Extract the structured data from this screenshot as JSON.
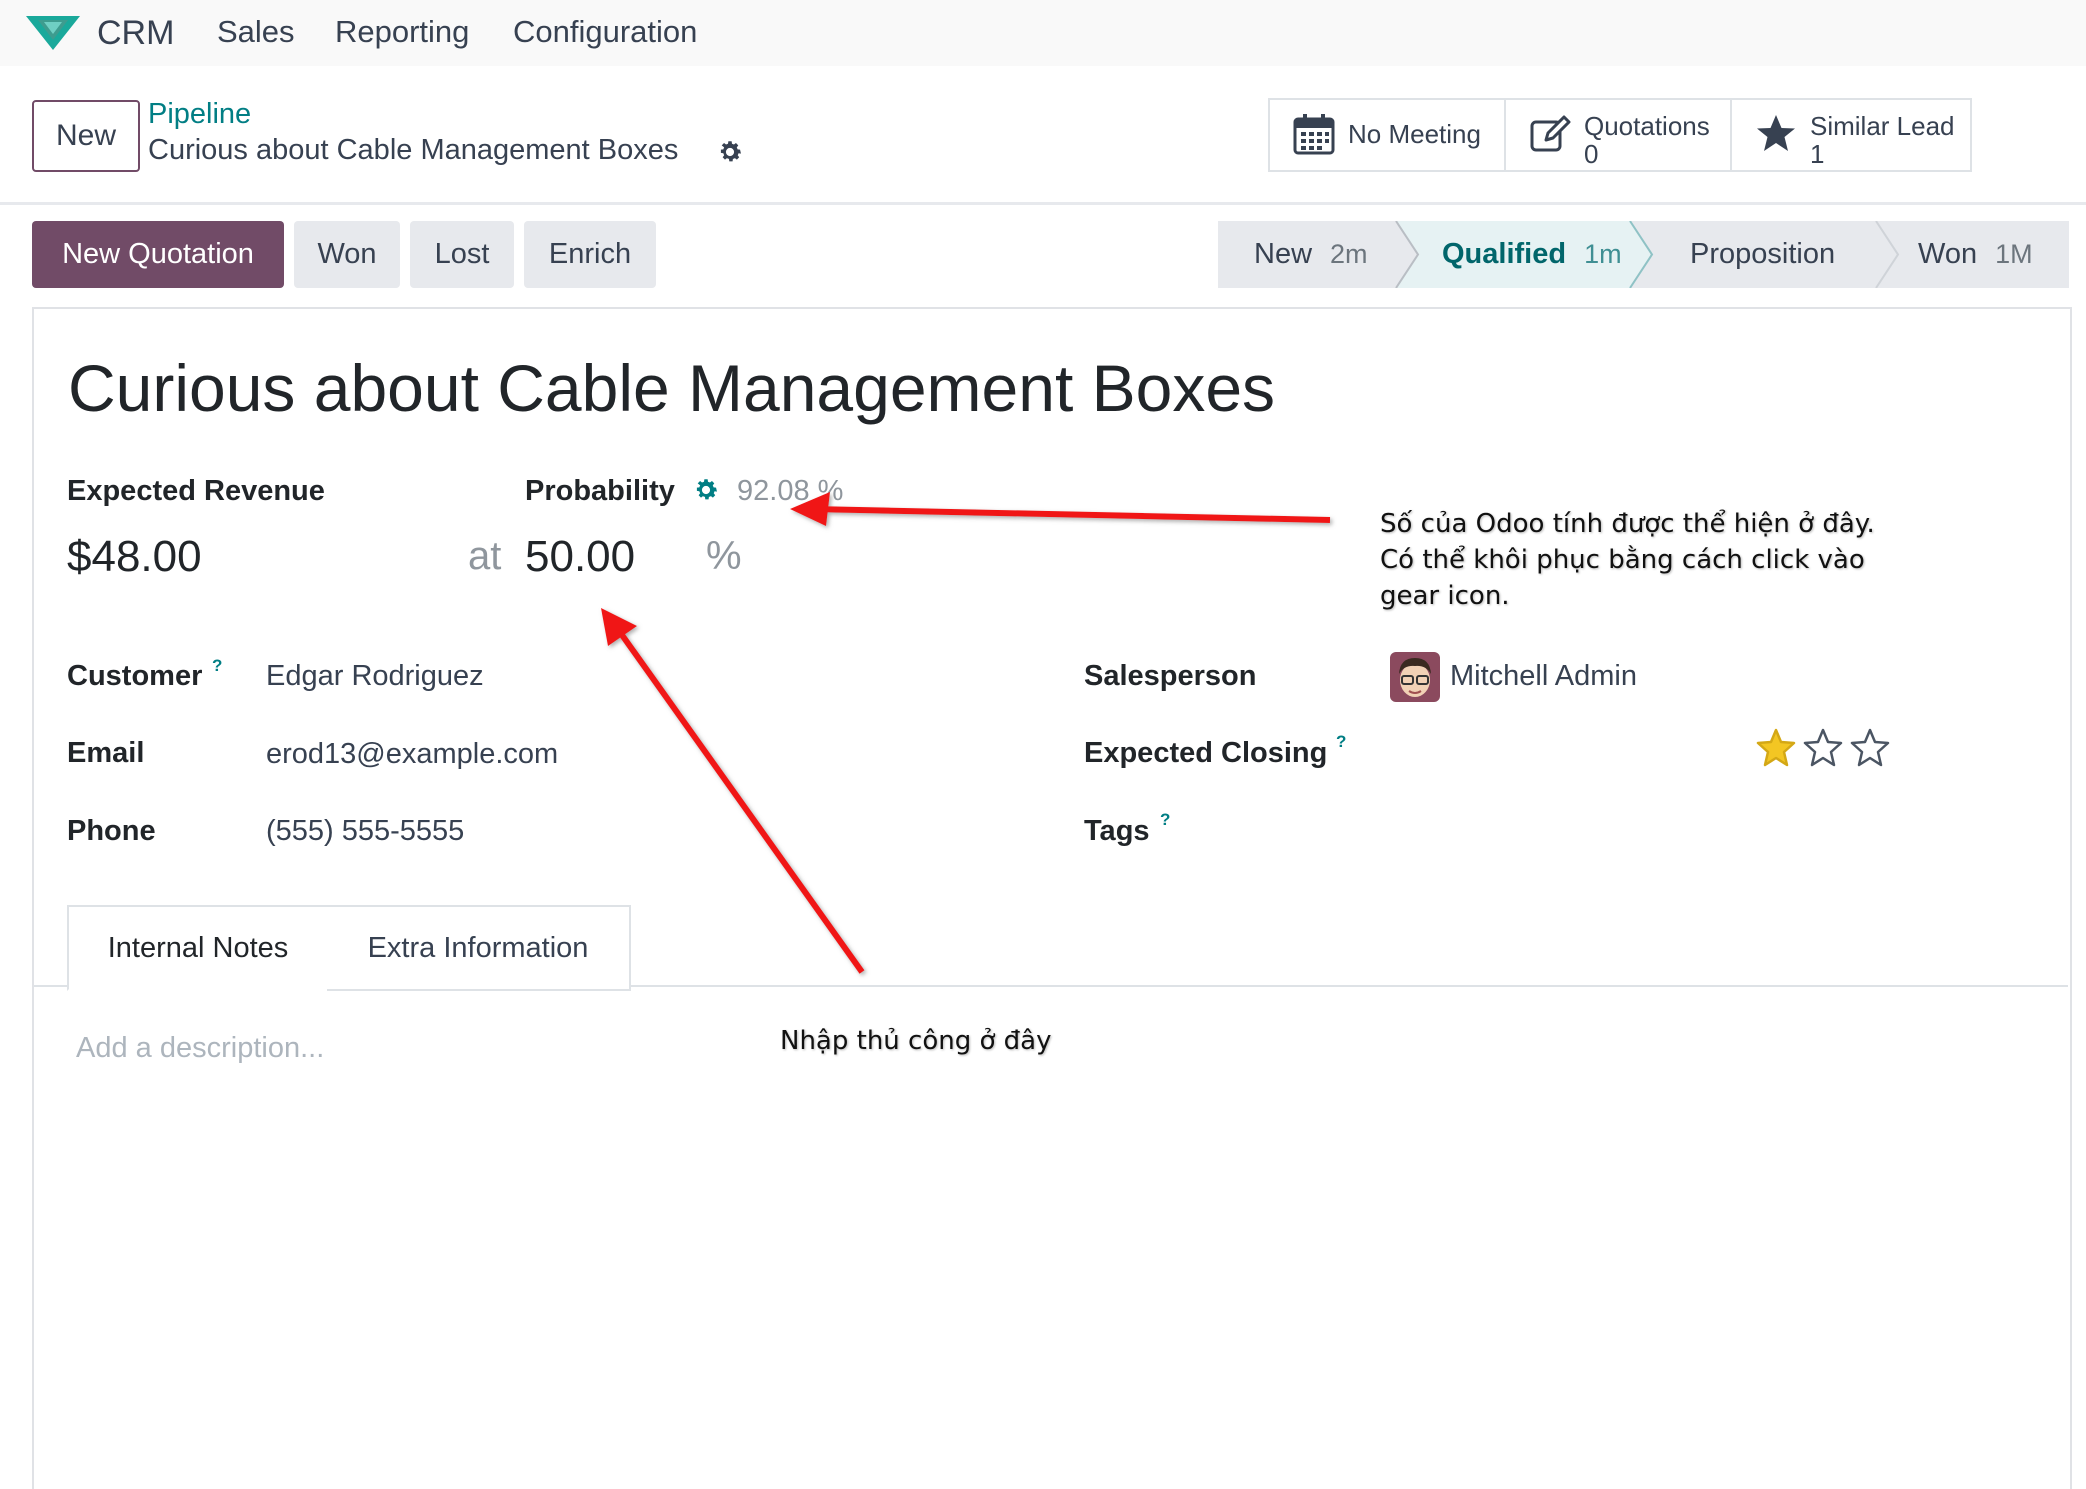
{
  "nav": {
    "app": "CRM",
    "items": [
      "Sales",
      "Reporting",
      "Configuration"
    ]
  },
  "control": {
    "new_label": "New",
    "breadcrumb": "Pipeline",
    "record_title": "Curious about Cable Management Boxes",
    "smart_buttons": [
      {
        "label": "No Meeting",
        "icon": "calendar-icon"
      },
      {
        "label": "Quotations",
        "count": "0",
        "icon": "edit-icon"
      },
      {
        "label": "Similar Lead",
        "count": "1",
        "icon": "star-icon"
      }
    ]
  },
  "actions": {
    "new_quotation": "New Quotation",
    "won": "Won",
    "lost": "Lost",
    "enrich": "Enrich"
  },
  "stages": [
    {
      "name": "New",
      "duration": "2m"
    },
    {
      "name": "Qualified",
      "duration": "1m",
      "active": true
    },
    {
      "name": "Proposition",
      "duration": ""
    },
    {
      "name": "Won",
      "duration": "1M"
    }
  ],
  "form": {
    "title": "Curious about Cable Management Boxes",
    "expected_revenue_label": "Expected Revenue",
    "expected_revenue": "$48.00",
    "probability_label": "Probability",
    "computed_probability": "92.08 %",
    "at": "at",
    "probability": "50.00",
    "percent": "%",
    "customer_label": "Customer",
    "customer": "Edgar Rodriguez",
    "email_label": "Email",
    "email": "erod13@example.com",
    "phone_label": "Phone",
    "phone": "(555) 555-5555",
    "salesperson_label": "Salesperson",
    "salesperson": "Mitchell Admin",
    "expected_closing_label": "Expected Closing",
    "tags_label": "Tags",
    "help_mark": "?",
    "priority_stars": 1,
    "priority_max": 3
  },
  "tabs": [
    "Internal Notes",
    "Extra Information"
  ],
  "notes_placeholder": "Add a description...",
  "annotations": {
    "top_lines": [
      "Số của Odoo tính được thể hiện ở đây.",
      "Có thể khôi phục bằng cách click vào",
      "gear icon."
    ],
    "bottom": "Nhập thủ công ở đây"
  },
  "colors": {
    "brand": "#714b67",
    "accent": "#017e84",
    "arrow": "#f01818",
    "star": "#f3c623"
  }
}
